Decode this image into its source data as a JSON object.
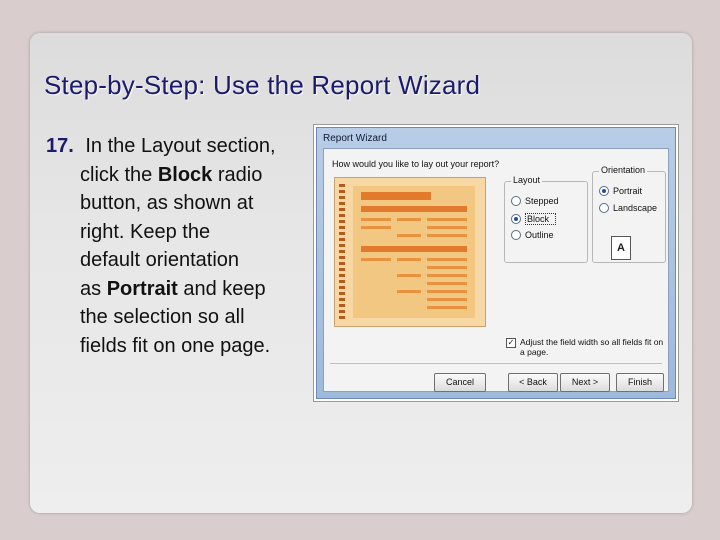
{
  "slide": {
    "title": "Step-by-Step: Use the Report Wizard",
    "step_number": "17.",
    "lines": [
      {
        "pre": "In the Layout section,",
        "bold": "",
        "post": ""
      },
      {
        "pre": "click the ",
        "bold": "Block",
        "post": " radio"
      },
      {
        "pre": "button, as shown at",
        "bold": "",
        "post": ""
      },
      {
        "pre": "right. Keep the",
        "bold": "",
        "post": ""
      },
      {
        "pre": "default orientation",
        "bold": "",
        "post": ""
      },
      {
        "pre": "as ",
        "bold": "Portrait",
        "post": " and keep"
      },
      {
        "pre": "the selection so all",
        "bold": "",
        "post": ""
      },
      {
        "pre": "fields fit on one page.",
        "bold": "",
        "post": ""
      }
    ]
  },
  "wizard": {
    "title": "Report Wizard",
    "question": "How would you like to lay out your report?",
    "layout": {
      "legend": "Layout",
      "options": [
        {
          "label": "Stepped",
          "selected": false
        },
        {
          "label": "Block",
          "selected": true
        },
        {
          "label": "Outline",
          "selected": false
        }
      ]
    },
    "orientation": {
      "legend": "Orientation",
      "options": [
        {
          "label": "Portrait",
          "selected": true
        },
        {
          "label": "Landscape",
          "selected": false
        }
      ],
      "icon_letter": "A"
    },
    "fit_checkbox": {
      "label": "Adjust the field width so all fields fit on a page.",
      "checked": true
    },
    "buttons": {
      "cancel": "Cancel",
      "back": "< Back",
      "next": "Next >",
      "finish": "Finish"
    }
  },
  "colors": {
    "title": "#1b1b6e",
    "slide_bg": "#e6e6e6",
    "outer_bg": "#d9cdcd",
    "preview_orange": "#e27a2e",
    "preview_bg": "#f7d7a3"
  }
}
